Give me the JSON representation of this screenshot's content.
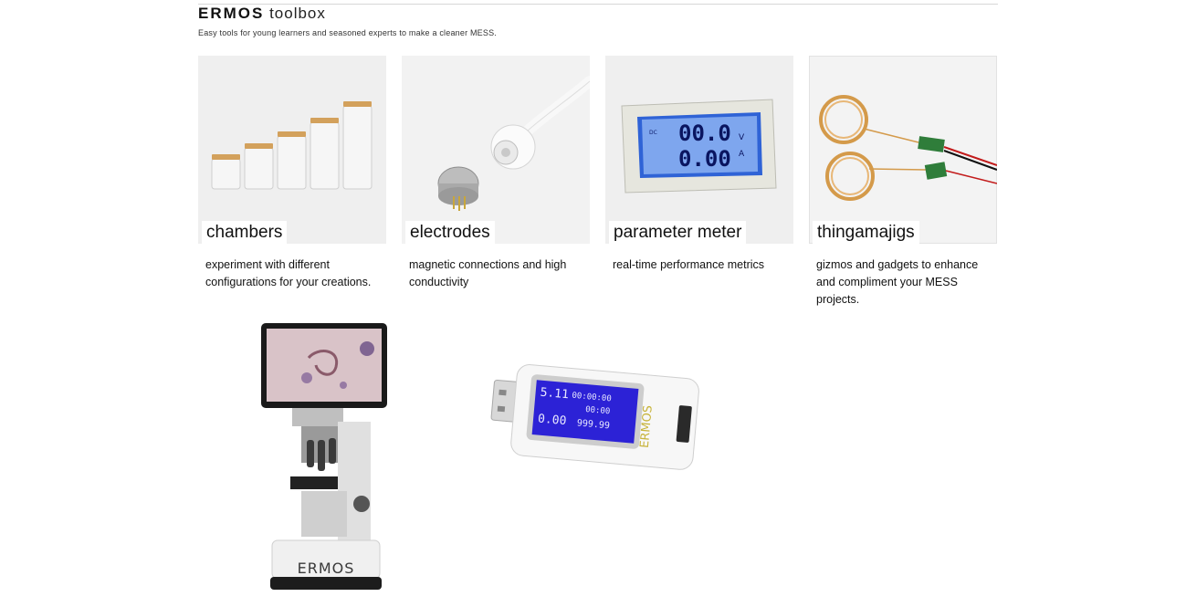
{
  "header": {
    "brand": "ERMOS",
    "title_rest": " toolbox",
    "subtitle": "Easy tools for young learners and seasoned experts to make a cleaner MESS."
  },
  "cards": [
    {
      "label": "chambers",
      "desc": "experiment with different configurations for your creations.",
      "icon": "glass-jars-image"
    },
    {
      "label": "electrodes",
      "desc": "magnetic connections and high conductivity",
      "icon": "magnetic-connector-image"
    },
    {
      "label": "parameter meter",
      "desc": "real-time performance metrics",
      "icon": "lcd-meter-image"
    },
    {
      "label": "thingamajigs",
      "desc": "gizmos and gadgets to enhance and compliment your MESS projects.",
      "icon": "wireless-coil-boards-image"
    }
  ],
  "meter_display": {
    "line1": "00.0",
    "unit1": "V",
    "line2": "0.00",
    "unit2": "A",
    "tag": "DC"
  },
  "microscope": {
    "brand_text": "ERMOS"
  },
  "usb_tester": {
    "brand_text": "ERMOS",
    "row1_left": "5.11",
    "row1_right": "00:00:00",
    "row2_right": "00:00",
    "row3_left": "0.00",
    "row3_right": "999.99"
  }
}
